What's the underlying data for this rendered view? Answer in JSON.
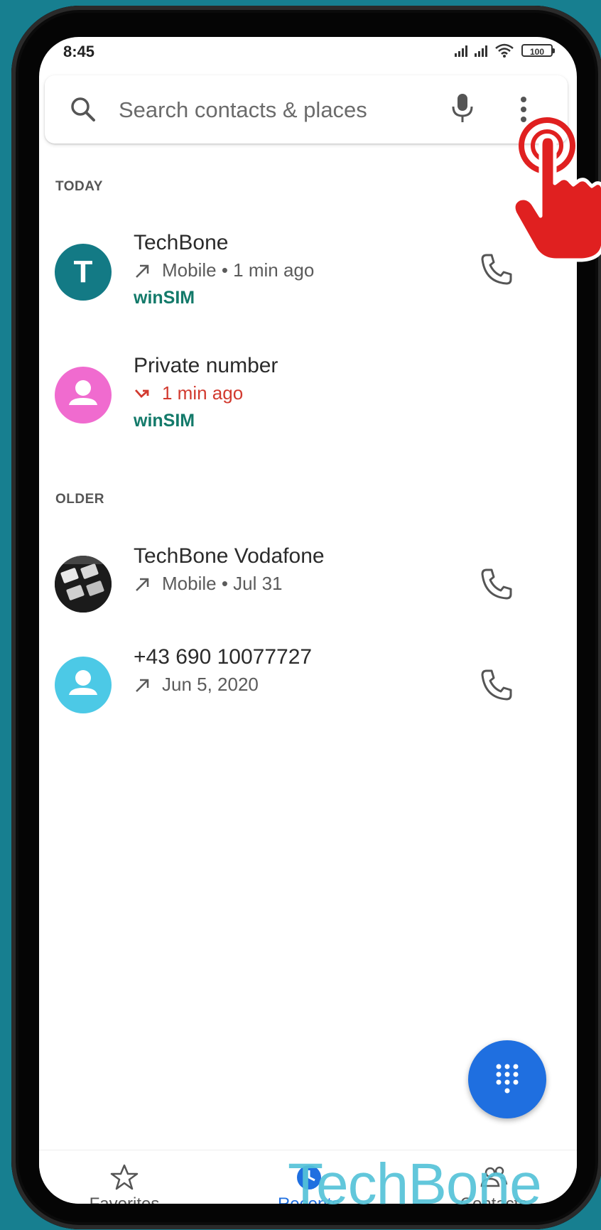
{
  "status_bar": {
    "time": "8:45",
    "battery": "100"
  },
  "search": {
    "placeholder": "Search contacts & places"
  },
  "sections": {
    "today": "TODAY",
    "older": "OLDER"
  },
  "calls": [
    {
      "name": "TechBone",
      "detail": "Mobile • 1 min ago",
      "sim": "winSIM",
      "avatar_letter": "T",
      "avatar_color": "#137a85",
      "type": "outgoing"
    },
    {
      "name": "Private number",
      "detail": "1 min ago",
      "sim": "winSIM",
      "avatar_color": "#f06bcf",
      "type": "missed"
    },
    {
      "name": "TechBone Vodafone",
      "detail": "Mobile • Jul 31",
      "type": "outgoing"
    },
    {
      "name": "+43 690 10077727",
      "detail": "Jun 5, 2020",
      "avatar_color": "#4cc9e6",
      "type": "outgoing"
    }
  ],
  "bottom_nav": [
    {
      "label": "Favorites",
      "icon": "star-icon"
    },
    {
      "label": "Recents",
      "icon": "clock-icon",
      "active": true
    },
    {
      "label": "Contacts",
      "icon": "people-icon"
    }
  ],
  "watermark": "TechBone",
  "colors": {
    "accent": "#1f6fe0",
    "sim": "#137a6a",
    "missed": "#d23a2f",
    "background": "#177f90"
  }
}
